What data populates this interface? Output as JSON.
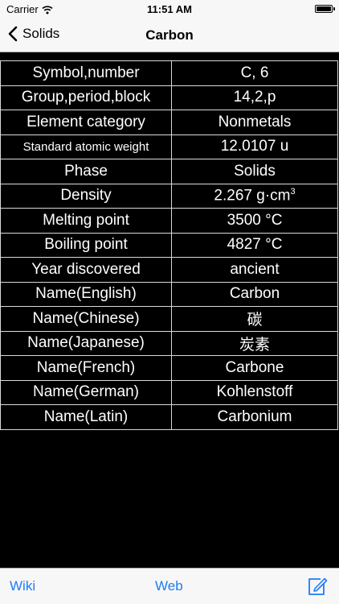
{
  "status": {
    "carrier": "Carrier",
    "time": "11:51 AM"
  },
  "nav": {
    "back_label": "Solids",
    "title": "Carbon"
  },
  "properties": [
    {
      "key": "Symbol,number",
      "value": "C, 6"
    },
    {
      "key": "Group,period,block",
      "value": "14,2,p"
    },
    {
      "key": "Element category",
      "value": "Nonmetals"
    },
    {
      "key": "Standard atomic weight",
      "value": "12.0107 u"
    },
    {
      "key": "Phase",
      "value": "Solids"
    },
    {
      "key": "Density",
      "value": "2.267 g·cm",
      "value_sup": "3"
    },
    {
      "key": "Melting point",
      "value": "3500 °C"
    },
    {
      "key": "Boiling point",
      "value": "4827 °C"
    },
    {
      "key": "Year discovered",
      "value": "ancient"
    },
    {
      "key": "Name(English)",
      "value": "Carbon"
    },
    {
      "key": "Name(Chinese)",
      "value": "碳"
    },
    {
      "key": "Name(Japanese)",
      "value": "炭素"
    },
    {
      "key": "Name(French)",
      "value": "Carbone"
    },
    {
      "key": "Name(German)",
      "value": "Kohlenstoff"
    },
    {
      "key": "Name(Latin)",
      "value": "Carbonium"
    }
  ],
  "toolbar": {
    "wiki_label": "Wiki",
    "web_label": "Web",
    "compose_icon": "compose-icon"
  },
  "colors": {
    "accent": "#1b7cf5",
    "background": "#000000",
    "chrome": "#f7f7f7"
  }
}
